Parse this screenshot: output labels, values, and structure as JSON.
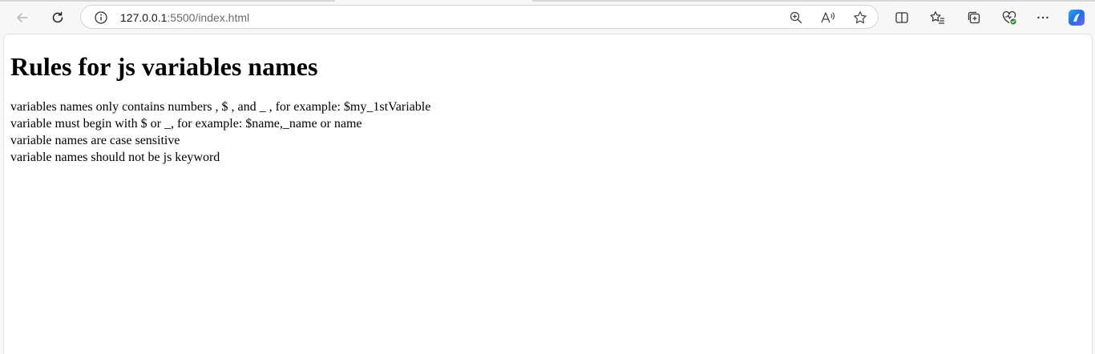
{
  "browser": {
    "url_host": "127.0.0.1",
    "url_path": ":5500/index.html",
    "copilot_accent": "#1f6feb",
    "favorites_badge": "#2e8b3a"
  },
  "page": {
    "heading": "Rules for js variables names",
    "rules": [
      "variables names only contains numbers , $ , and _ , for example: $my_1stVariable",
      "variable must begin with $ or _, for example: $name,_name or name",
      "variable names are case sensitive",
      "variable names should not be js keyword"
    ]
  }
}
